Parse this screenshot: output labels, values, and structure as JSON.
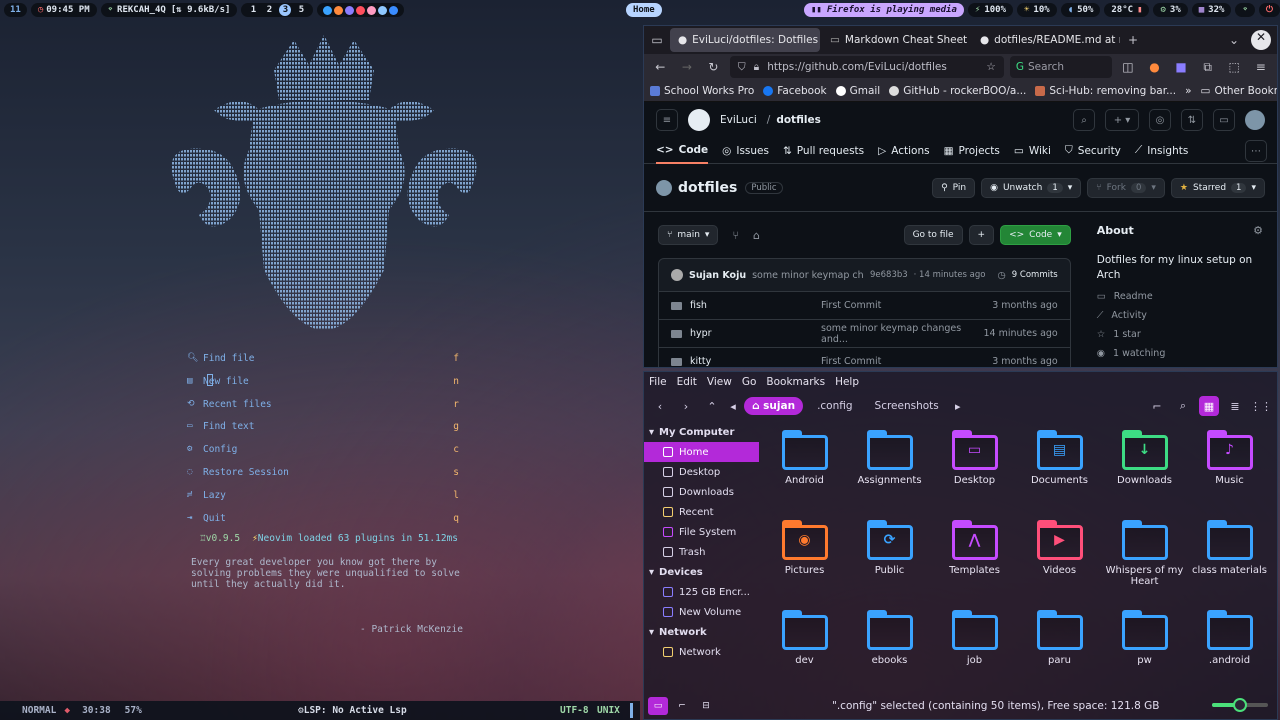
{
  "topbar": {
    "menu_icon": "11",
    "clock": "09:45 PM",
    "network": "REKCAH_4Q",
    "net_speed": "[⇅ 9.6kB/s]",
    "workspaces": [
      "1",
      "2",
      "3",
      "5"
    ],
    "active_workspace": "3",
    "window_title": "Home",
    "media": "Firefox is playing media",
    "battery": "100%",
    "brightness": "10%",
    "volume": "50%",
    "temperature": "28°C",
    "cpu": "3%",
    "memory": "32%",
    "notifications": "2"
  },
  "nvim": {
    "menu": [
      {
        "icon": "search-icon",
        "label": "Find file",
        "key": "f"
      },
      {
        "icon": "file-icon",
        "label": "New file",
        "key": "n"
      },
      {
        "icon": "recent-icon",
        "label": "Recent files",
        "key": "r"
      },
      {
        "icon": "text-search-icon",
        "label": "Find text",
        "key": "g"
      },
      {
        "icon": "gear-icon",
        "label": "Config",
        "key": "c"
      },
      {
        "icon": "restore-icon",
        "label": "Restore Session",
        "key": "s"
      },
      {
        "icon": "lazy-icon",
        "label": "Lazy",
        "key": "l"
      },
      {
        "icon": "quit-icon",
        "label": "Quit",
        "key": "q"
      }
    ],
    "version": "v0.9.5",
    "plugins_loaded": "Neovim loaded 63 plugins in 51.12ms",
    "quote": "Every great developer you know got there by solving problems they were unqualified to solve until they actually did it.",
    "quote_author": "- Patrick McKenzie",
    "status": {
      "mode": "NORMAL",
      "position": "30:38",
      "percent": "57%",
      "lsp": "LSP: No Active Lsp",
      "encoding": "UTF-8",
      "fileformat": "UNIX"
    }
  },
  "firefox": {
    "tabs": [
      {
        "label": "EviLuci/dotfiles: Dotfiles f",
        "active": true
      },
      {
        "label": "Markdown Cheat Sheet | M",
        "active": false
      },
      {
        "label": "dotfiles/README.md at m",
        "active": false
      }
    ],
    "url": "https://github.com/EviLuci/dotfiles",
    "search_placeholder": "Search",
    "bookmarks": [
      "School Works Pro",
      "Facebook",
      "Gmail",
      "GitHub - rockerBOO/a...",
      "Sci-Hub: removing bar..."
    ],
    "other_bookmarks": "Other Bookmarks",
    "github": {
      "owner": "EviLuci",
      "repo": "dotfiles",
      "tabs": [
        "Code",
        "Issues",
        "Pull requests",
        "Actions",
        "Projects",
        "Wiki",
        "Security",
        "Insights"
      ],
      "repo_name": "dotfiles",
      "visibility": "Public",
      "pin": "Pin",
      "unwatch": "Unwatch",
      "unwatch_count": "1",
      "fork": "Fork",
      "fork_count": "0",
      "starred": "Starred",
      "star_count": "1",
      "branch": "main",
      "go_to_file": "Go to file",
      "add": "+",
      "code_btn": "Code",
      "commit": {
        "author": "Sujan Koju",
        "message": "some minor keymap changes and ...",
        "hash": "9e683b3",
        "time": "· 14 minutes ago",
        "count": "9 Commits"
      },
      "files": [
        {
          "name": "fish",
          "message": "First Commit",
          "date": "3 months ago"
        },
        {
          "name": "hypr",
          "message": "some minor keymap changes and...",
          "date": "14 minutes ago"
        },
        {
          "name": "kitty",
          "message": "First Commit",
          "date": "3 months ago"
        }
      ],
      "about_title": "About",
      "about_desc": "Dotfiles for my linux setup on Arch",
      "about_items": [
        "Readme",
        "Activity",
        "1 star",
        "1 watching"
      ]
    }
  },
  "filemanager": {
    "menu": [
      "File",
      "Edit",
      "View",
      "Go",
      "Bookmarks",
      "Help"
    ],
    "breadcrumbs": [
      "sujan",
      ".config",
      "Screenshots"
    ],
    "sidebar": [
      {
        "type": "head",
        "label": "My Computer"
      },
      {
        "type": "item",
        "label": "Home",
        "active": true
      },
      {
        "type": "item",
        "label": "Desktop"
      },
      {
        "type": "item",
        "label": "Downloads"
      },
      {
        "type": "item",
        "label": "Recent"
      },
      {
        "type": "item",
        "label": "File System"
      },
      {
        "type": "item",
        "label": "Trash"
      },
      {
        "type": "head",
        "label": "Devices"
      },
      {
        "type": "item",
        "label": "125 GB Encr..."
      },
      {
        "type": "item",
        "label": "New Volume"
      },
      {
        "type": "head",
        "label": "Network"
      },
      {
        "type": "item",
        "label": "Network"
      }
    ],
    "items": [
      {
        "label": "Android",
        "color": "#3aa3ff",
        "glyph": ""
      },
      {
        "label": "Assignments",
        "color": "#3aa3ff",
        "glyph": ""
      },
      {
        "label": "Desktop",
        "color": "#c54bff",
        "glyph": "▭"
      },
      {
        "label": "Documents",
        "color": "#3aa3ff",
        "glyph": "▤"
      },
      {
        "label": "Downloads",
        "color": "#3ddc84",
        "glyph": "↓"
      },
      {
        "label": "Music",
        "color": "#c54bff",
        "glyph": "♪"
      },
      {
        "label": "Pictures",
        "color": "#ff7a2e",
        "glyph": "◉"
      },
      {
        "label": "Public",
        "color": "#3aa3ff",
        "glyph": "⟳"
      },
      {
        "label": "Templates",
        "color": "#c54bff",
        "glyph": "⋀"
      },
      {
        "label": "Videos",
        "color": "#ff4f7a",
        "glyph": "▶"
      },
      {
        "label": "Whispers of my Heart",
        "color": "#3aa3ff",
        "glyph": ""
      },
      {
        "label": "class materials",
        "color": "#3aa3ff",
        "glyph": ""
      },
      {
        "label": "dev",
        "color": "#3aa3ff",
        "glyph": ""
      },
      {
        "label": "ebooks",
        "color": "#3aa3ff",
        "glyph": ""
      },
      {
        "label": "job",
        "color": "#3aa3ff",
        "glyph": ""
      },
      {
        "label": "paru",
        "color": "#3aa3ff",
        "glyph": ""
      },
      {
        "label": "pw",
        "color": "#3aa3ff",
        "glyph": ""
      },
      {
        "label": ".android",
        "color": "#3aa3ff",
        "glyph": ""
      }
    ],
    "status": "\".config\" selected (containing 50 items), Free space: 121.8 GB",
    "zoom_level": 0.5
  }
}
